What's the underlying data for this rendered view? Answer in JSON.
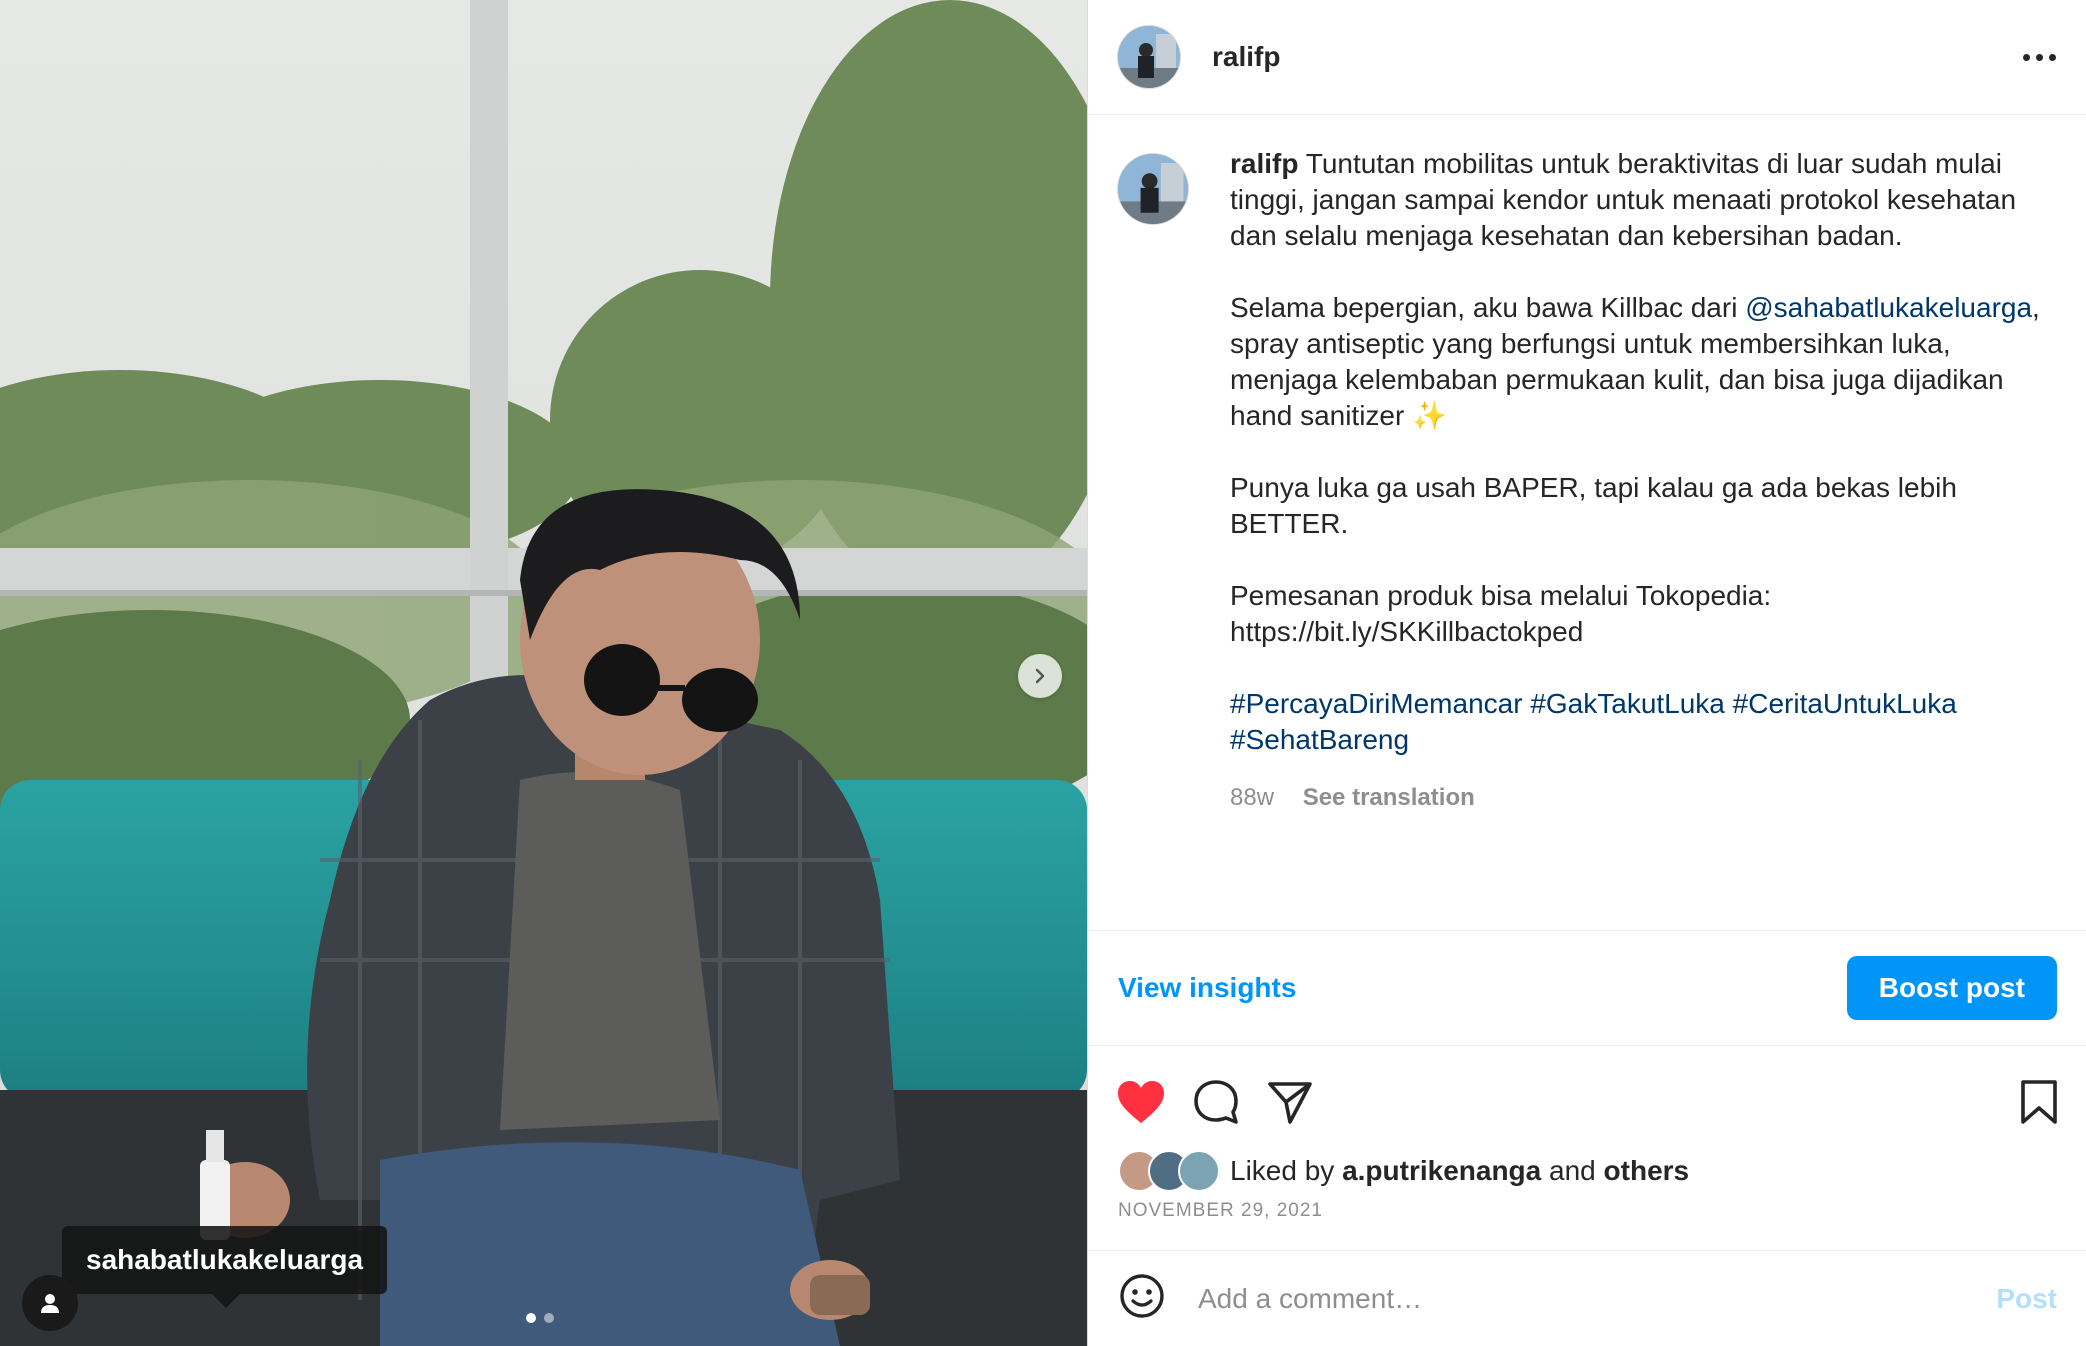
{
  "post": {
    "username": "ralifp",
    "caption": {
      "p1": "Tuntutan mobilitas untuk beraktivitas di luar sudah mulai tinggi, jangan sampai kendor untuk menaati protokol kesehatan dan selalu menjaga kesehatan dan kebersihan badan.",
      "p2_a": "Selama bepergian, aku bawa Killbac dari ",
      "p2_mention": "@sahabatlukakeluarga",
      "p2_b": ", spray antiseptic yang berfungsi untuk membersihkan luka, menjaga kelembaban permukaan kulit, dan bisa juga dijadikan hand sanitizer ✨",
      "p3": "Punya luka ga usah BAPER, tapi kalau ga ada bekas lebih BETTER.",
      "p4_a": "Pemesanan produk bisa melalui Tokopedia:",
      "p4_url": "https://bit.ly/SKKillbactokped",
      "hashtags": "#PercayaDiriMemancar #GakTakutLuka #CeritaUntukLuka #SehatBareng"
    },
    "age": "88w",
    "see_translation": "See translation",
    "view_insights": "View insights",
    "boost_post": "Boost post",
    "liked_prefix": "Liked by ",
    "liked_user": "a.putrikenanga",
    "liked_and": " and ",
    "liked_others": "others",
    "date": "NOVEMBER 29, 2021",
    "comment_placeholder": "Add a comment…",
    "post_label": "Post",
    "photo_tag": "sahabatlukakeluarga",
    "carousel_count": 2,
    "carousel_active": 1
  },
  "icons": {
    "more": "more-options-icon",
    "like": "heart-icon",
    "comment": "comment-icon",
    "share": "share-icon",
    "save": "bookmark-icon",
    "emoji": "emoji-icon",
    "next": "chevron-right-icon",
    "user_tag": "user-tag-icon"
  },
  "colors": {
    "accent": "#0095f6",
    "link": "#00376b",
    "heart": "#ff3040",
    "muted": "#8e8e8e"
  }
}
